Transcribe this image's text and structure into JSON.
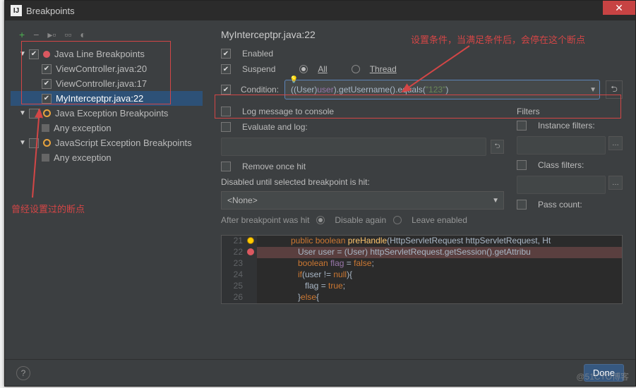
{
  "titlebar": {
    "title": "Breakpoints",
    "close": "✕",
    "icon_txt": "IJ"
  },
  "toolbar": {
    "plus": "+",
    "minus": "−"
  },
  "tree": {
    "cat1": {
      "label": "Java Line Breakpoints"
    },
    "items1": [
      {
        "label": "ViewController.java:20"
      },
      {
        "label": "ViewController.java:17"
      },
      {
        "label": "MyInterceptpr.java:22"
      }
    ],
    "cat2": {
      "label": "Java Exception Breakpoints"
    },
    "items2": [
      {
        "label": "Any exception"
      }
    ],
    "cat3": {
      "label": "JavaScript Exception Breakpoints"
    },
    "items3": [
      {
        "label": "Any exception"
      }
    ]
  },
  "main": {
    "heading": "MyInterceptpr.java:22",
    "enabled": "Enabled",
    "suspend": "Suspend",
    "all": "All",
    "thread": "Thread",
    "condition_label": "Condition:",
    "condition_code": {
      "p1": "((User)",
      "p2": " user",
      "p3": ").getUsername().equals(",
      "p4": "\"123\"",
      "p5": ")"
    },
    "log_msg": "Log message to console",
    "eval_log": "Evaluate and log:",
    "remove_once": "Remove once hit",
    "disabled_until": "Disabled until selected breakpoint is hit:",
    "none": "<None>",
    "after_hit": "After breakpoint was hit",
    "disable_again": "Disable again",
    "leave_enabled": "Leave enabled",
    "filters_title": "Filters",
    "instance_filters": "Instance filters:",
    "class_filters": "Class filters:",
    "pass_count": "Pass count:"
  },
  "code": {
    "lines": [
      "21",
      "22",
      "23",
      "24",
      "25",
      "26"
    ],
    "l21": {
      "a": "         public boolean ",
      "b": "preHandle",
      "c": "(HttpServletRequest httpServletRequest, Ht"
    },
    "l22": {
      "a": "            User user = (User) httpServletRequest.getSession().getAttribu"
    },
    "l23": {
      "a": "            boolean ",
      "b": "flag",
      "c": " = ",
      "d": "false",
      "e": ";"
    },
    "l24": {
      "a": "            if",
      "b": "(user != ",
      "c": "null",
      "d": "){"
    },
    "l25": {
      "a": "               flag = ",
      "b": "true",
      "c": ";"
    },
    "l26": {
      "a": "            }",
      "b": "else",
      "c": "{"
    }
  },
  "footer": {
    "help": "?",
    "done": "Done"
  },
  "annotations": {
    "top": "设置条件，当满足条件后，会停在这个断点",
    "bottom": "曾经设置过的断点"
  },
  "watermark": "@51CTO博客"
}
